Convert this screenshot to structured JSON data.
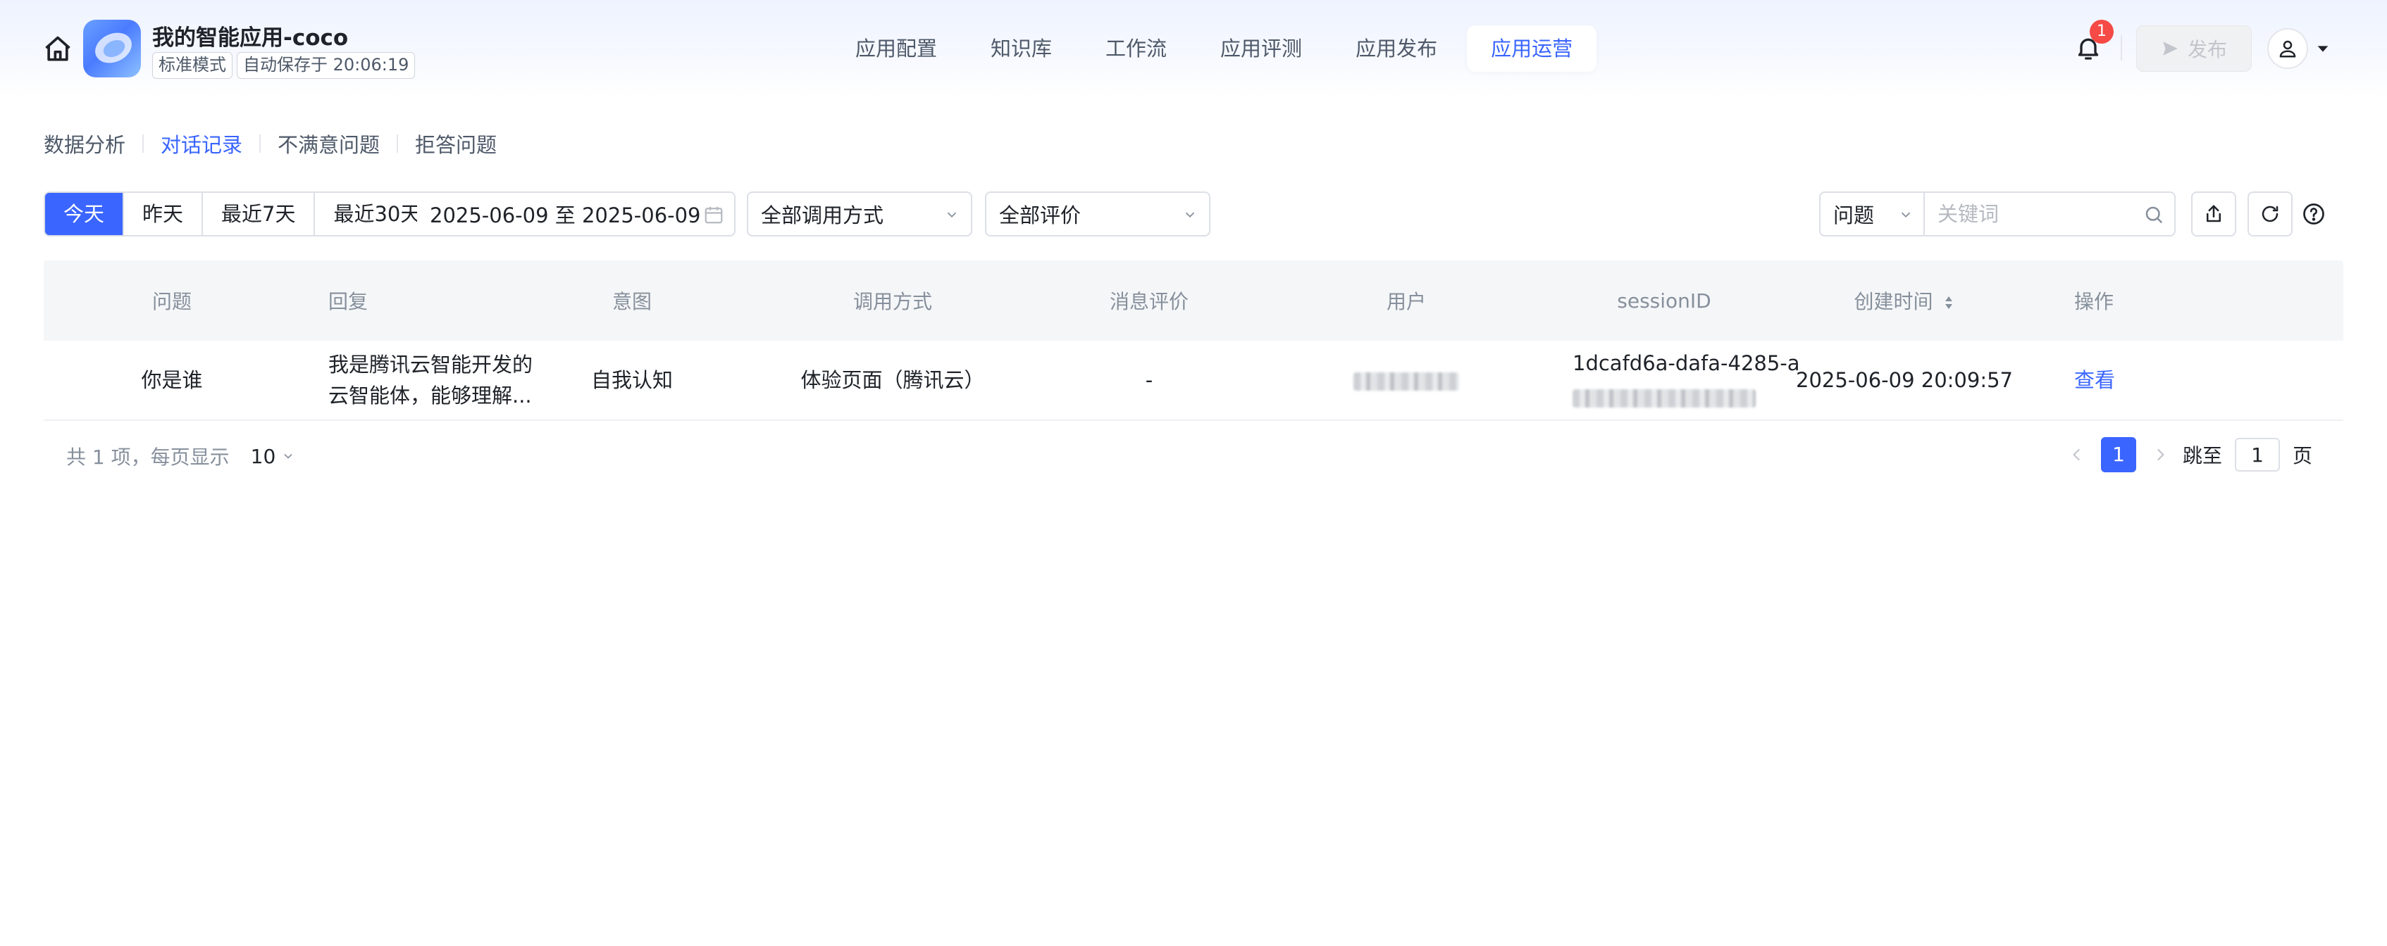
{
  "header": {
    "app_name": "我的智能应用-coco",
    "mode_tag": "标准模式",
    "autosave_tag": "自动保存于 20:06:19",
    "home_icon": "home-icon",
    "nav_tabs": [
      {
        "label": "应用配置"
      },
      {
        "label": "知识库"
      },
      {
        "label": "工作流"
      },
      {
        "label": "应用评测"
      },
      {
        "label": "应用发布"
      },
      {
        "label": "应用运营",
        "active": true
      }
    ],
    "notification_count": "1",
    "publish_label": "发布"
  },
  "subtabs": [
    {
      "label": "数据分析"
    },
    {
      "label": "对话记录",
      "active": true
    },
    {
      "label": "不满意问题"
    },
    {
      "label": "拒答问题"
    }
  ],
  "filters": {
    "quick_ranges": [
      {
        "label": "今天",
        "active": true
      },
      {
        "label": "昨天"
      },
      {
        "label": "最近7天"
      },
      {
        "label": "最近30天"
      }
    ],
    "date_range": "2025-06-09 至 2025-06-09",
    "invoke_method": "全部调用方式",
    "rating": "全部评价",
    "search_type": "问题",
    "search_placeholder": "关键词"
  },
  "table": {
    "headers": {
      "question": "问题",
      "reply": "回复",
      "intent": "意图",
      "method": "调用方式",
      "rating": "消息评价",
      "user": "用户",
      "session": "sessionID",
      "created": "创建时间",
      "ops": "操作"
    },
    "rows": [
      {
        "question": "你是谁",
        "reply": "我是腾讯云智能开发的云智能体，能够理解...",
        "intent": "自我认知",
        "method": "体验页面（腾讯云）",
        "rating": "-",
        "session_visible": "1dcafd6a-dafa-4285-a",
        "created": "2025-06-09 20:09:57",
        "action": "查看"
      }
    ]
  },
  "pagination": {
    "summary": "共 1 项，每页显示",
    "page_size": "10",
    "current_page": "1",
    "jump_label": "跳至",
    "jump_value": "1",
    "page_suffix": "页"
  },
  "colors": {
    "accent": "#3a65ff",
    "badge": "#f54a45",
    "header_bg": "#f5f6f8"
  }
}
